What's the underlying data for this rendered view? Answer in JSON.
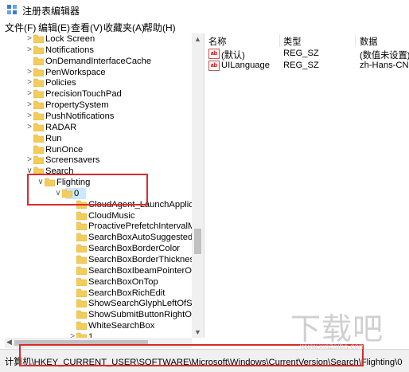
{
  "window": {
    "title": "注册表编辑器"
  },
  "menu": [
    "文件(F)",
    "编辑(E)",
    "查看(V)",
    "收藏夹(A)",
    "帮助(H)"
  ],
  "tree": [
    {
      "label": "Lock Screen",
      "chevron": ">"
    },
    {
      "label": "Notifications",
      "chevron": ">"
    },
    {
      "label": "OnDemandInterfaceCache",
      "chevron": ""
    },
    {
      "label": "PenWorkspace",
      "chevron": ">"
    },
    {
      "label": "Policies",
      "chevron": ">"
    },
    {
      "label": "PrecisionTouchPad",
      "chevron": ">"
    },
    {
      "label": "PropertySystem",
      "chevron": ">"
    },
    {
      "label": "PushNotifications",
      "chevron": ">"
    },
    {
      "label": "RADAR",
      "chevron": ">"
    },
    {
      "label": "Run",
      "chevron": ""
    },
    {
      "label": "RunOnce",
      "chevron": ""
    },
    {
      "label": "Screensavers",
      "chevron": ">"
    },
    {
      "label": "Search",
      "chevron": "∨"
    },
    {
      "label": "Flighting",
      "chevron": "∨"
    },
    {
      "label": "0",
      "chevron": "∨"
    },
    {
      "label": "CloudAgent_LaunchApplica",
      "chevron": ""
    },
    {
      "label": "CloudMusic",
      "chevron": ""
    },
    {
      "label": "ProactivePrefetchIntervalMi",
      "chevron": ""
    },
    {
      "label": "SearchBoxAutoSuggestedF",
      "chevron": ""
    },
    {
      "label": "SearchBoxBorderColor",
      "chevron": ""
    },
    {
      "label": "SearchBoxBorderThickness",
      "chevron": ""
    },
    {
      "label": "SearchBoxIbeamPointerOnł",
      "chevron": ""
    },
    {
      "label": "SearchBoxOnTop",
      "chevron": ""
    },
    {
      "label": "SearchBoxRichEdit",
      "chevron": ""
    },
    {
      "label": "ShowSearchGlyphLeftOfSea",
      "chevron": ""
    },
    {
      "label": "ShowSubmitButtonRightOfS",
      "chevron": ""
    },
    {
      "label": "WhiteSearchBox",
      "chevron": ""
    },
    {
      "label": "1",
      "chevron": ">"
    }
  ],
  "list": {
    "columns": [
      "名称",
      "类型",
      "数据"
    ],
    "rows": [
      {
        "icon": "ab",
        "name": "(默认)",
        "type": "REG_SZ",
        "data": "(数值未设置)"
      },
      {
        "icon": "ab",
        "name": "UILanguage",
        "type": "REG_SZ",
        "data": "zh-Hans-CN"
      }
    ]
  },
  "status": {
    "path": "计算机\\HKEY_CURRENT_USER\\SOFTWARE\\Microsoft\\Windows\\CurrentVersion\\Search\\Flighting\\0"
  },
  "watermark": {
    "text": "下载吧",
    "url": "www.xiazaiba.com"
  },
  "colors": {
    "folder": "#f3cc5b",
    "folder_dark": "#d9a93a",
    "highlight": "#d92b2b",
    "selected_bg": "#cce8ff"
  },
  "icons": {
    "app": "regedit-icon",
    "folder": "folder-icon",
    "value": "reg-sz-icon"
  }
}
